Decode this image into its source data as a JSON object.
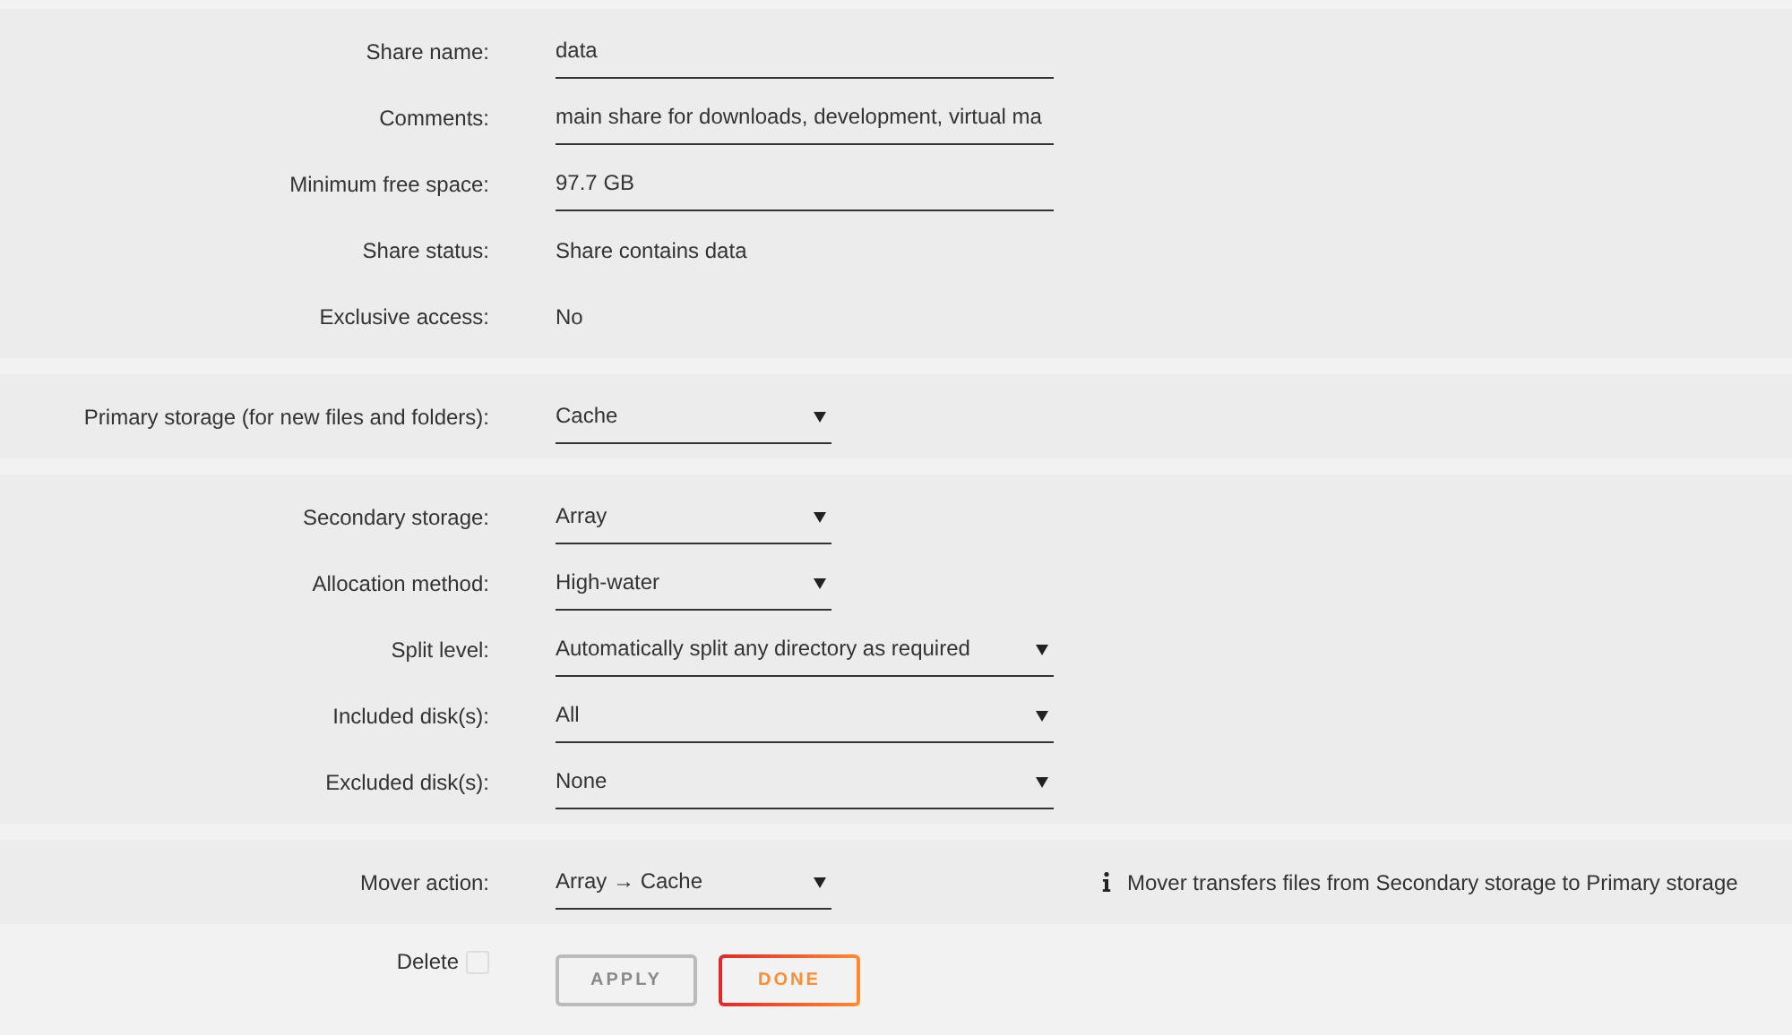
{
  "sections": [
    {
      "rows": [
        {
          "label": "Share name:",
          "kind": "text",
          "value": "data"
        },
        {
          "label": "Comments:",
          "kind": "text",
          "value": "main share for downloads, development, virtual ma"
        },
        {
          "label": "Minimum free space:",
          "kind": "text",
          "value": "97.7 GB"
        },
        {
          "label": "Share status:",
          "kind": "static",
          "value": "Share contains data"
        },
        {
          "label": "Exclusive access:",
          "kind": "static",
          "value": "No"
        }
      ]
    },
    {
      "rows": [
        {
          "label": "Primary storage (for new files and folders):",
          "kind": "short-select",
          "value": "Cache"
        }
      ]
    },
    {
      "rows": [
        {
          "label": "Secondary storage:",
          "kind": "short-select",
          "value": "Array"
        },
        {
          "label": "Allocation method:",
          "kind": "short-select",
          "value": "High-water"
        },
        {
          "label": "Split level:",
          "kind": "select",
          "value": "Automatically split any directory as required"
        },
        {
          "label": "Included disk(s):",
          "kind": "select",
          "value": "All"
        },
        {
          "label": "Excluded disk(s):",
          "kind": "select",
          "value": "None"
        }
      ]
    },
    {
      "rows": [
        {
          "label": "Mover action:",
          "kind": "short-select",
          "value": "Array → Cache",
          "note": "Mover transfers files from Secondary storage to Primary storage"
        }
      ]
    }
  ],
  "footer": {
    "delete": {
      "label": "Delete",
      "checked": false
    },
    "buttons": [
      {
        "label": "APPLY",
        "kind": "apply",
        "disabled": true
      },
      {
        "label": "DONE",
        "kind": "done",
        "disabled": false
      }
    ]
  }
}
